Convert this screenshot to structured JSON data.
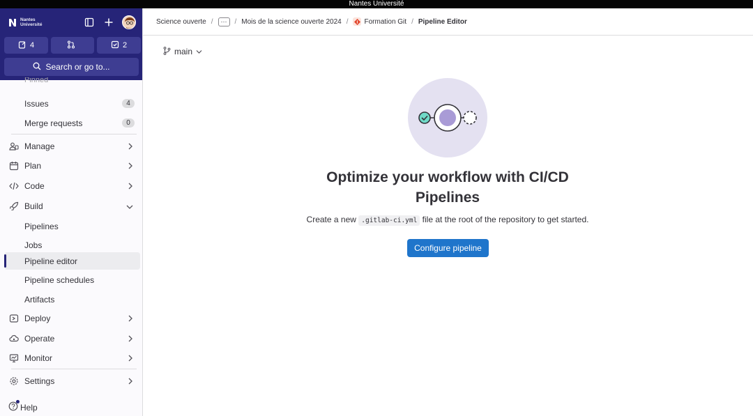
{
  "system_bar": {
    "title": "Nantes Université"
  },
  "sidebar": {
    "brand": {
      "line1": "Nantes",
      "line2": "Université"
    },
    "counts": [
      {
        "icon": "issues-icon",
        "value": "4"
      },
      {
        "icon": "merge-request-icon",
        "value": ""
      },
      {
        "icon": "todo-icon",
        "value": "2"
      }
    ],
    "search_label": "Search or go to...",
    "pinned_label": "Pinned",
    "items": [
      {
        "label": "Issues",
        "badge": "4"
      },
      {
        "label": "Merge requests",
        "badge": "0"
      },
      {
        "label": "Manage"
      },
      {
        "label": "Plan"
      },
      {
        "label": "Code"
      },
      {
        "label": "Build"
      },
      {
        "label": "Pipelines"
      },
      {
        "label": "Jobs"
      },
      {
        "label": "Pipeline editor"
      },
      {
        "label": "Pipeline schedules"
      },
      {
        "label": "Artifacts"
      },
      {
        "label": "Deploy"
      },
      {
        "label": "Operate"
      },
      {
        "label": "Monitor"
      },
      {
        "label": "Settings"
      }
    ],
    "help_label": "Help"
  },
  "breadcrumb": {
    "items": [
      "Science ouverte",
      "Mois de la science ouverte 2024",
      "Formation Git",
      "Pipeline Editor"
    ]
  },
  "branch": {
    "name": "main"
  },
  "empty_state": {
    "title": "Optimize your workflow with CI/CD Pipelines",
    "desc_before": "Create a new ",
    "desc_code": ".gitlab-ci.yml",
    "desc_after": " file at the root of the repository to get started.",
    "cta_label": "Configure pipeline"
  },
  "colors": {
    "sidebar_top": "#262478",
    "primary_button": "#1f75cb",
    "illustration_bg": "#e4e1f1"
  }
}
